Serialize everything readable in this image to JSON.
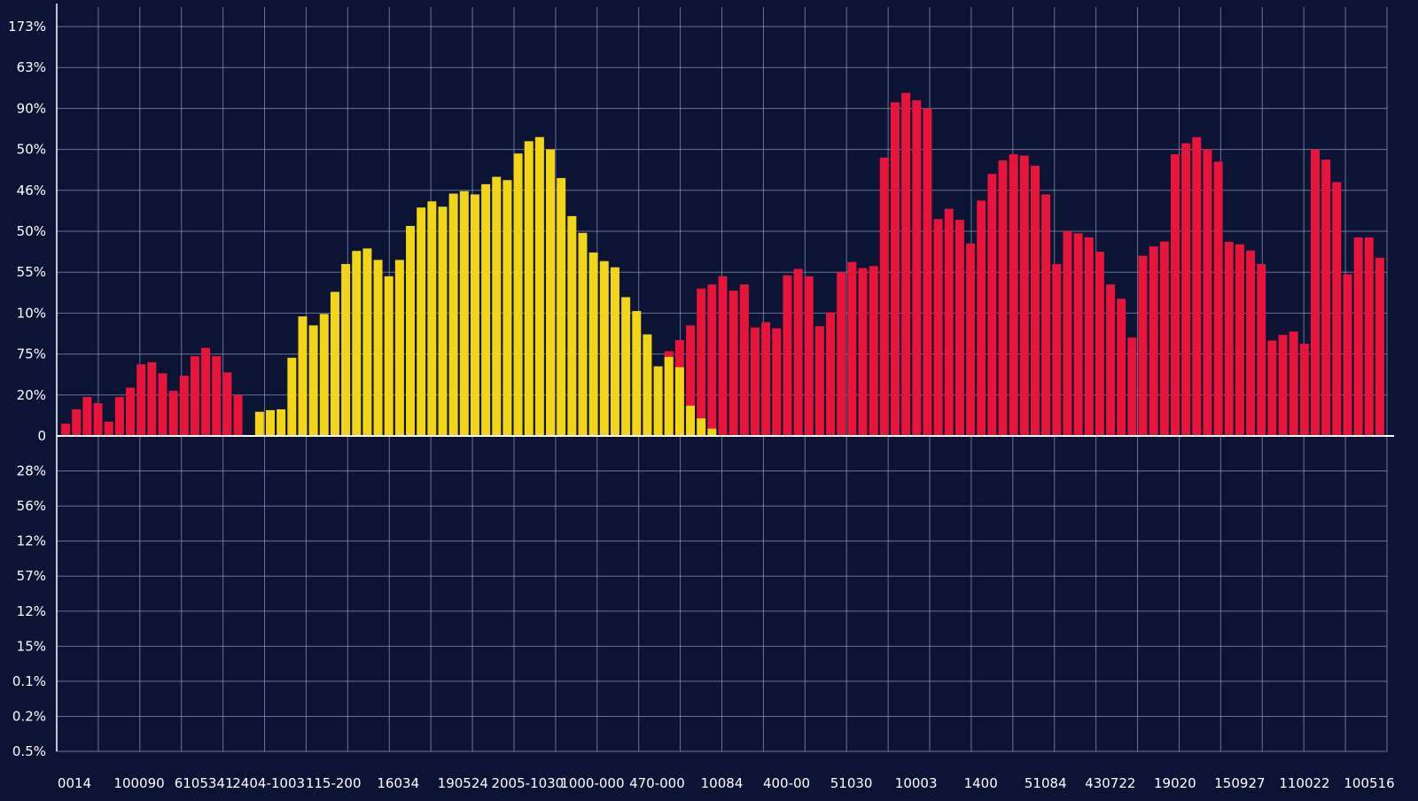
{
  "chart_data": {
    "type": "bar",
    "colors": {
      "background": "#0c1436",
      "grid": "#8a93b8",
      "axis": "#ffffff",
      "label": "#ffffff",
      "yellow": "#f2d517",
      "red": "#e8143a",
      "orange": "#f08a1e"
    },
    "grid": true,
    "ylim": [
      -100,
      100
    ],
    "y_tick_labels": [
      "173%",
      "63%",
      "90%",
      "50%",
      "46%",
      "50%",
      "55%",
      "10%",
      "75%",
      "20%",
      "0",
      "28%",
      "56%",
      "12%",
      "57%",
      "12%",
      "15%",
      "0.1%",
      "0.2%",
      "0.5%"
    ],
    "x_tick_labels": [
      "0014",
      "100090",
      "6105341",
      "2404-1003",
      "115-200",
      "16034",
      "190524",
      "2005-1030",
      "1000-000",
      "470-000",
      "10084",
      "400-00",
      "51030",
      "10003",
      "1400",
      "51084",
      "430722",
      "19020",
      "150927",
      "110022",
      "100516"
    ],
    "series": [
      {
        "color_key": "red",
        "values": [
          3,
          6.5,
          9.5,
          8,
          3.5,
          9.5,
          11.8,
          17.5,
          18,
          15.3,
          11,
          14.7,
          19.5,
          21.5,
          19.5,
          15.5,
          10,
          0,
          0,
          0,
          0,
          0,
          0,
          0,
          0,
          0,
          0,
          0,
          0,
          0,
          0,
          0,
          0,
          0,
          0,
          0,
          0,
          0,
          0,
          0,
          0,
          0,
          0,
          0,
          0,
          0,
          0,
          0,
          0,
          0,
          0,
          0,
          0,
          0,
          0,
          0,
          20.7,
          23.4,
          27,
          36,
          37,
          39,
          35.5,
          37,
          26.5,
          27.8,
          26.3,
          39.2,
          40.8,
          39,
          26.8,
          30.2,
          40,
          42.5,
          41,
          41.5,
          68,
          81.5,
          83.8,
          82,
          80,
          53,
          55.5,
          52.8,
          47,
          57.5,
          64,
          67.3,
          68.8,
          68.5,
          66,
          59,
          42,
          50,
          49.5,
          48.5,
          45,
          37,
          33.5,
          24,
          44,
          46.3,
          47.5,
          68.8,
          71.5,
          73,
          70,
          67,
          47.4,
          46.8,
          45.3,
          42,
          23.3,
          24.7,
          25.5,
          22.5,
          70,
          67.5,
          62,
          39.5,
          48.5,
          48.5,
          43.5
        ]
      },
      {
        "color_key": "yellow",
        "values": [
          0,
          0,
          0,
          0,
          0,
          0,
          0,
          0,
          0,
          0,
          0,
          0,
          0,
          0,
          0,
          0,
          0,
          0,
          5.9,
          6.3,
          6.5,
          19.1,
          29.2,
          27,
          29.8,
          35.2,
          42,
          45.2,
          45.8,
          43,
          39,
          43,
          51.3,
          55.8,
          57.3,
          56,
          59.2,
          59.8,
          59,
          61.5,
          63.3,
          62.5,
          69,
          72,
          73,
          70,
          63,
          53.7,
          49.6,
          44.8,
          42.7,
          41.2,
          33.9,
          30.5,
          24.8,
          17,
          19.3,
          16.8,
          7.4,
          4.3,
          1.8,
          0,
          0,
          0,
          0,
          0,
          0,
          0,
          0,
          0,
          0,
          0,
          0,
          0,
          0,
          0,
          0,
          0,
          0,
          0,
          0,
          0,
          0,
          0,
          0,
          0,
          0,
          0,
          0,
          0,
          0,
          0,
          0,
          0,
          0,
          0,
          0,
          0,
          0,
          0,
          0,
          0,
          0,
          0,
          0,
          0,
          0,
          0,
          0,
          0,
          0,
          0,
          0,
          0,
          0,
          0,
          0,
          0,
          0,
          0,
          0,
          0,
          0,
          0
        ]
      }
    ]
  }
}
